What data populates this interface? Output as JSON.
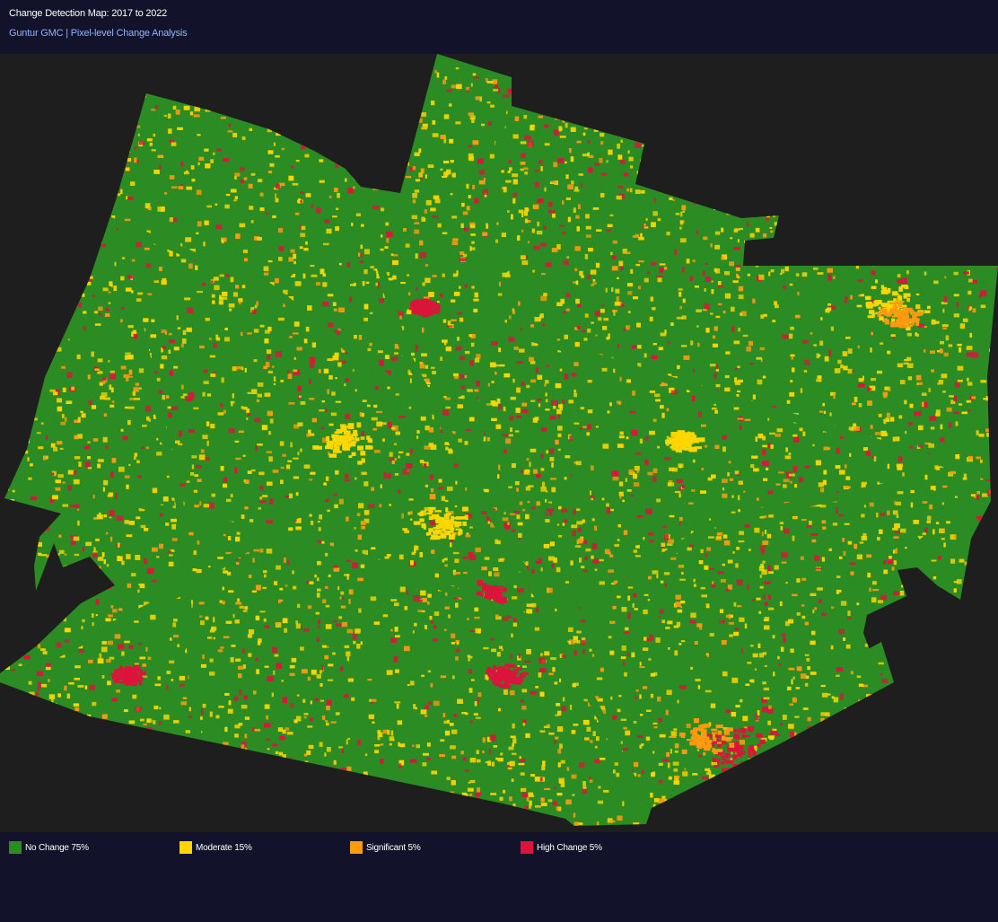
{
  "header": {
    "title": "Change Detection Map: 2017 to 2022",
    "subtitle": "Guntur GMC | Pixel-level Change Analysis"
  },
  "map": {
    "region": "Guntur GMC",
    "background_color": "#1e1e1e",
    "base_color": "#2a8c22"
  },
  "legend": {
    "items": [
      {
        "label": "No Change 75%",
        "color": "#2a8c22",
        "share": 0.75
      },
      {
        "label": "Moderate 15%",
        "color": "#ffd600",
        "share": 0.15
      },
      {
        "label": "Significant 5%",
        "color": "#ff9a10",
        "share": 0.05
      },
      {
        "label": "High Change 5%",
        "color": "#dc143c",
        "share": 0.05
      }
    ]
  }
}
